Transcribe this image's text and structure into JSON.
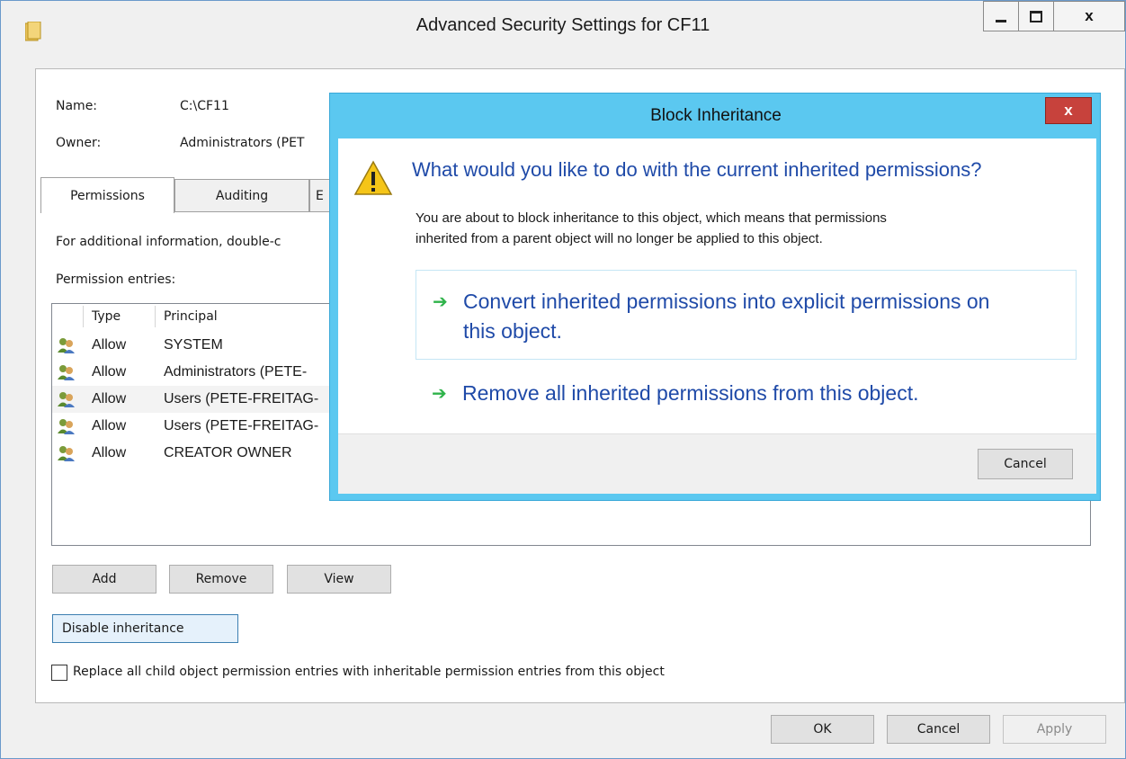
{
  "window": {
    "title": "Advanced Security Settings for CF11",
    "controls": {
      "minimize": "—",
      "maximize": "□",
      "close": "x"
    }
  },
  "fields": {
    "name_label": "Name:",
    "name_value": "C:\\CF11",
    "owner_label": "Owner:",
    "owner_value": "Administrators (PET"
  },
  "tabs": [
    {
      "label": "Permissions",
      "selected": true
    },
    {
      "label": "Auditing",
      "selected": false
    },
    {
      "label": "E",
      "selected": false
    }
  ],
  "info_text": "For additional information, double-c",
  "entries_label": "Permission entries:",
  "table": {
    "headers": [
      "Type",
      "Principal"
    ],
    "rows": [
      {
        "type": "Allow",
        "principal": "SYSTEM"
      },
      {
        "type": "Allow",
        "principal": "Administrators (PETE-"
      },
      {
        "type": "Allow",
        "principal": "Users (PETE-FREITAG-"
      },
      {
        "type": "Allow",
        "principal": "Users (PETE-FREITAG-"
      },
      {
        "type": "Allow",
        "principal": "CREATOR OWNER"
      }
    ]
  },
  "buttons": {
    "add": "Add",
    "remove": "Remove",
    "view": "View",
    "disable_inheritance": "Disable inheritance",
    "ok": "OK",
    "cancel": "Cancel",
    "apply": "Apply"
  },
  "replace_checkbox": {
    "label": "Replace all child object permission entries with inheritable permission entries from this object",
    "checked": false
  },
  "dialog": {
    "title": "Block Inheritance",
    "close": "x",
    "question": "What would you like to do with the current inherited permissions?",
    "description_line1": "You are about to block inheritance to this object, which means that permissions",
    "description_line2": "inherited from a parent object will no longer be applied to this object.",
    "option1_line1": "Convert inherited permissions into explicit permissions on",
    "option1_line2": "this object.",
    "option2": "Remove all inherited permissions from this object.",
    "arrow": "➔",
    "cancel": "Cancel"
  },
  "colors": {
    "dialog_accent": "#5bc8f0",
    "link_blue": "#1f4aa8",
    "arrow_green": "#2fb34a",
    "close_red": "#c7423c"
  }
}
